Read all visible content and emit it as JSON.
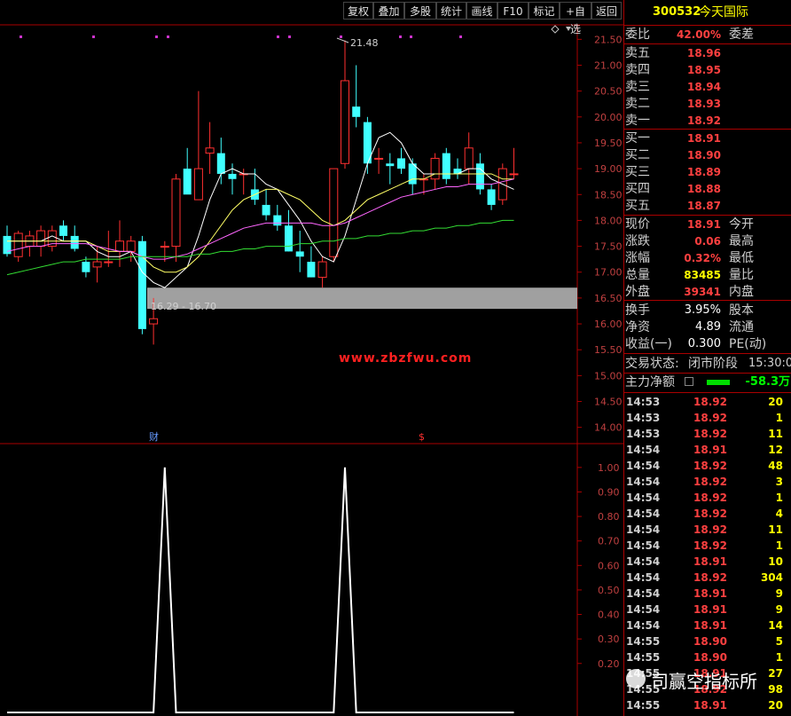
{
  "toolbar": {
    "buttons": [
      "复权",
      "叠加",
      "多股",
      "统计",
      "画线",
      "F10",
      "标记",
      "+自选",
      "返回"
    ]
  },
  "header": {
    "code": "300532",
    "name": "今天国际"
  },
  "order_book": {
    "weibi_label": "委比",
    "weibi_value": "42.00%",
    "weicha_label": "委差",
    "sell": [
      {
        "label": "卖五",
        "price": "18.96"
      },
      {
        "label": "卖四",
        "price": "18.95"
      },
      {
        "label": "卖三",
        "price": "18.94"
      },
      {
        "label": "卖二",
        "price": "18.93"
      },
      {
        "label": "卖一",
        "price": "18.92"
      }
    ],
    "buy": [
      {
        "label": "买一",
        "price": "18.91"
      },
      {
        "label": "买二",
        "price": "18.90"
      },
      {
        "label": "买三",
        "price": "18.89"
      },
      {
        "label": "买四",
        "price": "18.88"
      },
      {
        "label": "买五",
        "price": "18.87"
      }
    ]
  },
  "quote": [
    {
      "label": "现价",
      "value": "18.91",
      "label2": "今开",
      "color": "red"
    },
    {
      "label": "涨跌",
      "value": "0.06",
      "label2": "最高",
      "color": "red"
    },
    {
      "label": "涨幅",
      "value": "0.32%",
      "label2": "最低",
      "color": "red"
    },
    {
      "label": "总量",
      "value": "83485",
      "label2": "量比",
      "color": "yellow"
    },
    {
      "label": "外盘",
      "value": "39341",
      "label2": "内盘",
      "color": "red"
    }
  ],
  "stats": [
    {
      "label": "换手",
      "value": "3.95%",
      "label2": "股本"
    },
    {
      "label": "净资",
      "value": "4.89",
      "label2": "流通"
    },
    {
      "label": "收益(一)",
      "value": "0.300",
      "label2": "PE(动)"
    }
  ],
  "trade_status": {
    "label": "交易状态:",
    "value": "闭市阶段",
    "time": "15:30:0"
  },
  "main_flow": {
    "label": "主力净额",
    "value": "-58.3万"
  },
  "ticks": [
    {
      "time": "14:53",
      "price": "18.92",
      "vol": "20",
      "vcolor": "yellow"
    },
    {
      "time": "14:53",
      "price": "18.92",
      "vol": "1",
      "vcolor": "yellow"
    },
    {
      "time": "14:53",
      "price": "18.92",
      "vol": "11",
      "vcolor": "yellow"
    },
    {
      "time": "14:54",
      "price": "18.91",
      "vol": "12",
      "vcolor": "yellow"
    },
    {
      "time": "14:54",
      "price": "18.92",
      "vol": "48",
      "vcolor": "yellow"
    },
    {
      "time": "14:54",
      "price": "18.92",
      "vol": "3",
      "vcolor": "yellow"
    },
    {
      "time": "14:54",
      "price": "18.92",
      "vol": "1",
      "vcolor": "yellow"
    },
    {
      "time": "14:54",
      "price": "18.92",
      "vol": "4",
      "vcolor": "yellow"
    },
    {
      "time": "14:54",
      "price": "18.92",
      "vol": "11",
      "vcolor": "yellow"
    },
    {
      "time": "14:54",
      "price": "18.92",
      "vol": "1",
      "vcolor": "yellow"
    },
    {
      "time": "14:54",
      "price": "18.91",
      "vol": "10",
      "vcolor": "yellow"
    },
    {
      "time": "14:54",
      "price": "18.92",
      "vol": "304",
      "vcolor": "yellow"
    },
    {
      "time": "14:54",
      "price": "18.91",
      "vol": "9",
      "vcolor": "yellow"
    },
    {
      "time": "14:54",
      "price": "18.91",
      "vol": "9",
      "vcolor": "yellow"
    },
    {
      "time": "14:54",
      "price": "18.91",
      "vol": "14",
      "vcolor": "yellow"
    },
    {
      "time": "14:55",
      "price": "18.90",
      "vol": "5",
      "vcolor": "yellow"
    },
    {
      "time": "14:55",
      "price": "18.90",
      "vol": "1",
      "vcolor": "yellow"
    },
    {
      "time": "14:55",
      "price": "18.91",
      "vol": "27",
      "vcolor": "yellow"
    },
    {
      "time": "14:55",
      "price": "18.92",
      "vol": "98",
      "vcolor": "yellow"
    },
    {
      "time": "14:55",
      "price": "18.91",
      "vol": "20",
      "vcolor": "yellow"
    }
  ],
  "watermark": "www.zbzfwu.com",
  "wechat_label": "司赢空指标所",
  "chart_data": [
    {
      "type": "candlestick",
      "ylim": [
        13.8,
        21.7
      ],
      "y_ticks": [
        "21.50",
        "21.00",
        "20.50",
        "20.00",
        "19.50",
        "19.00",
        "18.50",
        "18.00",
        "17.50",
        "17.00",
        "16.50",
        "16.00",
        "15.50",
        "15.00",
        "14.50",
        "14.00"
      ],
      "annotations": {
        "high": "21.48",
        "range": "16.29 - 16.70",
        "marker_cai": "财",
        "marker_s": "$"
      },
      "candles": [
        {
          "o": 17.7,
          "h": 17.9,
          "l": 17.3,
          "c": 17.35
        },
        {
          "o": 17.3,
          "h": 17.8,
          "l": 17.2,
          "c": 17.75
        },
        {
          "o": 17.5,
          "h": 17.8,
          "l": 17.3,
          "c": 17.7
        },
        {
          "o": 17.5,
          "h": 17.9,
          "l": 17.3,
          "c": 17.8
        },
        {
          "o": 17.5,
          "h": 17.9,
          "l": 17.4,
          "c": 17.8
        },
        {
          "o": 17.9,
          "h": 18.0,
          "l": 17.6,
          "c": 17.7
        },
        {
          "o": 17.7,
          "h": 17.9,
          "l": 17.4,
          "c": 17.45
        },
        {
          "o": 17.2,
          "h": 17.3,
          "l": 16.9,
          "c": 17.0
        },
        {
          "o": 17.1,
          "h": 17.5,
          "l": 16.8,
          "c": 17.2
        },
        {
          "o": 17.2,
          "h": 17.8,
          "l": 17.1,
          "c": 17.2
        },
        {
          "o": 17.4,
          "h": 18.0,
          "l": 17.1,
          "c": 17.6
        },
        {
          "o": 17.4,
          "h": 17.7,
          "l": 17.2,
          "c": 17.6
        },
        {
          "o": 17.6,
          "h": 17.7,
          "l": 15.8,
          "c": 15.9
        },
        {
          "o": 16.0,
          "h": 16.5,
          "l": 15.6,
          "c": 16.1
        },
        {
          "o": 17.5,
          "h": 17.6,
          "l": 17.2,
          "c": 17.5
        },
        {
          "o": 17.5,
          "h": 18.9,
          "l": 17.2,
          "c": 18.8
        },
        {
          "o": 19.0,
          "h": 19.4,
          "l": 18.6,
          "c": 18.5
        },
        {
          "o": 18.4,
          "h": 20.5,
          "l": 18.4,
          "c": 19.0
        },
        {
          "o": 19.3,
          "h": 19.9,
          "l": 18.9,
          "c": 19.4
        },
        {
          "o": 19.3,
          "h": 19.6,
          "l": 18.7,
          "c": 18.9
        },
        {
          "o": 18.9,
          "h": 19.1,
          "l": 18.5,
          "c": 18.8
        },
        {
          "o": 18.9,
          "h": 19.0,
          "l": 18.5,
          "c": 18.9
        },
        {
          "o": 18.6,
          "h": 19.0,
          "l": 18.3,
          "c": 18.4
        },
        {
          "o": 18.3,
          "h": 18.6,
          "l": 18.0,
          "c": 18.1
        },
        {
          "o": 18.1,
          "h": 18.3,
          "l": 17.8,
          "c": 17.9
        },
        {
          "o": 17.9,
          "h": 18.2,
          "l": 17.4,
          "c": 17.4
        },
        {
          "o": 17.4,
          "h": 17.8,
          "l": 17.0,
          "c": 17.3
        },
        {
          "o": 17.2,
          "h": 17.5,
          "l": 16.9,
          "c": 16.9
        },
        {
          "o": 16.9,
          "h": 17.3,
          "l": 16.7,
          "c": 17.2
        },
        {
          "o": 17.3,
          "h": 19.0,
          "l": 17.2,
          "c": 19.0
        },
        {
          "o": 19.1,
          "h": 21.48,
          "l": 19.0,
          "c": 20.7
        },
        {
          "o": 20.2,
          "h": 21.0,
          "l": 19.8,
          "c": 20.0
        },
        {
          "o": 19.9,
          "h": 20.0,
          "l": 18.9,
          "c": 19.1
        },
        {
          "o": 19.2,
          "h": 19.4,
          "l": 18.9,
          "c": 19.2
        },
        {
          "o": 19.1,
          "h": 19.3,
          "l": 18.7,
          "c": 19.05
        },
        {
          "o": 19.2,
          "h": 19.4,
          "l": 18.9,
          "c": 19.0
        },
        {
          "o": 19.1,
          "h": 19.2,
          "l": 18.5,
          "c": 18.7
        },
        {
          "o": 18.8,
          "h": 18.9,
          "l": 18.5,
          "c": 18.8
        },
        {
          "o": 18.8,
          "h": 19.3,
          "l": 18.6,
          "c": 19.2
        },
        {
          "o": 19.3,
          "h": 19.4,
          "l": 18.7,
          "c": 18.8
        },
        {
          "o": 19.0,
          "h": 19.2,
          "l": 18.8,
          "c": 18.9
        },
        {
          "o": 19.0,
          "h": 19.7,
          "l": 18.7,
          "c": 19.4
        },
        {
          "o": 19.1,
          "h": 19.3,
          "l": 18.5,
          "c": 18.6
        },
        {
          "o": 18.6,
          "h": 18.7,
          "l": 18.2,
          "c": 18.3
        },
        {
          "o": 18.4,
          "h": 19.1,
          "l": 18.3,
          "c": 19.0
        },
        {
          "o": 18.9,
          "h": 19.4,
          "l": 18.8,
          "c": 18.9
        }
      ],
      "ma_series": [
        {
          "color": "#ffffff",
          "values": [
            17.6,
            17.6,
            17.6,
            17.6,
            17.7,
            17.6,
            17.6,
            17.6,
            17.4,
            17.3,
            17.3,
            17.4,
            17.0,
            16.8,
            16.7,
            16.9,
            17.1,
            17.7,
            18.4,
            18.9,
            19.0,
            18.9,
            18.9,
            18.7,
            18.6,
            18.3,
            18.0,
            17.6,
            17.3,
            17.2,
            17.7,
            18.4,
            19.1,
            19.6,
            19.7,
            19.5,
            19.1,
            18.9,
            18.9,
            18.9,
            18.9,
            19.0,
            19.0,
            18.8,
            18.7,
            18.6
          ]
        },
        {
          "color": "#ffff66",
          "values": [
            17.6,
            17.6,
            17.6,
            17.6,
            17.6,
            17.6,
            17.6,
            17.6,
            17.5,
            17.4,
            17.4,
            17.4,
            17.3,
            17.1,
            17.0,
            17.0,
            17.1,
            17.3,
            17.6,
            17.9,
            18.2,
            18.4,
            18.5,
            18.6,
            18.6,
            18.5,
            18.4,
            18.2,
            18.0,
            17.9,
            18.0,
            18.2,
            18.4,
            18.5,
            18.6,
            18.7,
            18.8,
            18.8,
            18.9,
            18.9,
            18.9,
            18.9,
            18.9,
            18.9,
            18.8,
            18.8
          ]
        },
        {
          "color": "#ff66ff",
          "values": [
            17.4,
            17.45,
            17.5,
            17.5,
            17.55,
            17.55,
            17.55,
            17.55,
            17.5,
            17.45,
            17.4,
            17.4,
            17.3,
            17.25,
            17.25,
            17.3,
            17.35,
            17.45,
            17.55,
            17.65,
            17.75,
            17.85,
            17.9,
            17.95,
            17.95,
            17.95,
            17.95,
            17.95,
            17.9,
            17.9,
            17.95,
            18.05,
            18.15,
            18.25,
            18.35,
            18.45,
            18.5,
            18.55,
            18.6,
            18.65,
            18.65,
            18.7,
            18.7,
            18.7,
            18.75,
            18.8
          ]
        },
        {
          "color": "#33dd33",
          "values": [
            16.95,
            17.0,
            17.05,
            17.1,
            17.15,
            17.2,
            17.2,
            17.25,
            17.25,
            17.25,
            17.25,
            17.3,
            17.3,
            17.3,
            17.3,
            17.3,
            17.3,
            17.35,
            17.35,
            17.4,
            17.4,
            17.45,
            17.45,
            17.5,
            17.5,
            17.5,
            17.55,
            17.55,
            17.6,
            17.6,
            17.65,
            17.65,
            17.7,
            17.7,
            17.75,
            17.75,
            17.8,
            17.8,
            17.85,
            17.85,
            17.9,
            17.9,
            17.95,
            17.95,
            18.0,
            18.0
          ]
        }
      ]
    },
    {
      "type": "line",
      "ylim": [
        0.0,
        1.05
      ],
      "y_ticks": [
        "1.00",
        "0.90",
        "0.80",
        "0.70",
        "0.60",
        "0.50",
        "0.40",
        "0.30",
        "0.20"
      ],
      "values": [
        0,
        0,
        0,
        0,
        0,
        0,
        0,
        0,
        0,
        0,
        0,
        0,
        0,
        0,
        1,
        0,
        0,
        0,
        0,
        0,
        0,
        0,
        0,
        0,
        0,
        0,
        0,
        0,
        0,
        0,
        1,
        0,
        0,
        0,
        0,
        0,
        0,
        0,
        0,
        0,
        0,
        0,
        0,
        0,
        0,
        0
      ]
    }
  ]
}
